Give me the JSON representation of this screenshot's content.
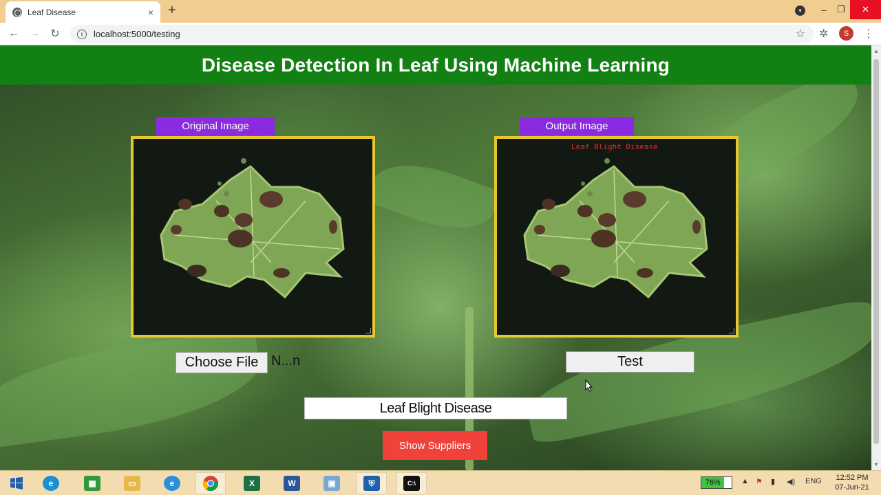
{
  "browser": {
    "tab_title": "Leaf Disease",
    "tab_close": "×",
    "new_tab": "+",
    "url": "localhost:5000/testing",
    "profile_initial": "S",
    "window_controls": [
      "–",
      "❐",
      "✕"
    ]
  },
  "page": {
    "title": "Disease Detection In Leaf Using Machine Learning",
    "original_label": "Original Image",
    "output_label": "Output Image",
    "output_overlay": "Leaf Blight Disease",
    "choose_file": "Choose File",
    "file_name": "N...n",
    "test_button": "Test",
    "result": "Leaf Blight Disease",
    "suppliers_button": "Show Suppliers"
  },
  "taskbar": {
    "battery": "76%",
    "language": "ENG",
    "time": "12:52 PM",
    "date": "07-Jun-21",
    "apps": [
      "start",
      "edge",
      "store",
      "file-explorer",
      "internet-explorer",
      "chrome",
      "excel",
      "word",
      "photos",
      "security",
      "command-prompt"
    ]
  },
  "colors": {
    "header_green": "#128012",
    "label_purple": "#8a2be2",
    "frame_yellow": "#e8c62e",
    "suppliers_red": "#f0413a",
    "overlay_red": "#e53030"
  }
}
